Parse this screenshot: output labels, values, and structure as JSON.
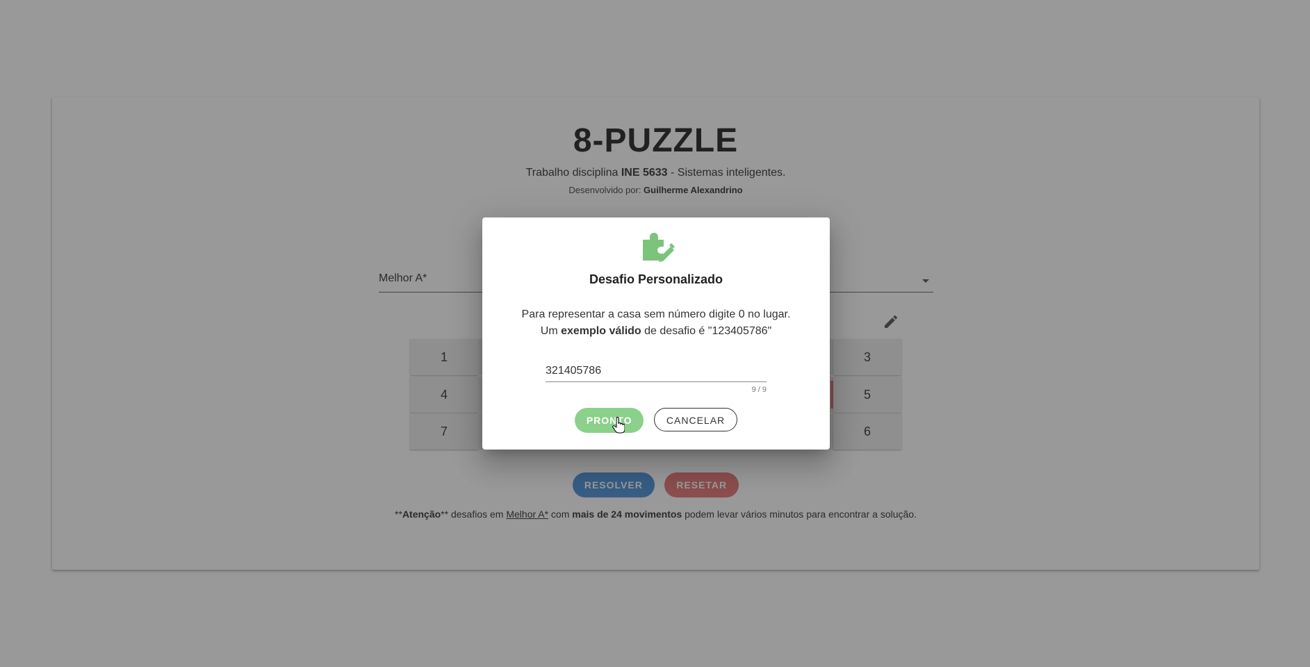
{
  "page": {
    "title": "8-PUZZLE",
    "subtitle_prefix": "Trabalho disciplina ",
    "subtitle_bold": "INE 5633",
    "subtitle_suffix": " - Sistemas inteligentes.",
    "author_prefix": "Desenvolvido por: ",
    "author_name": "Guilherme Alexandrino"
  },
  "algorithm_select": {
    "value": "Melhor A*"
  },
  "board": {
    "tiles_left": [
      "1",
      "4",
      "7"
    ],
    "tiles_right": [
      "3",
      "5",
      "6"
    ]
  },
  "actions": {
    "solve_label": "RESOLVER",
    "reset_label": "RESETAR"
  },
  "note": {
    "p1": "**",
    "b1": "Atenção",
    "p2": "** desafios em ",
    "link": "Melhor A*",
    "p3": " com ",
    "b2": "mais de 24 movimentos",
    "p4": " podem levar vários minutos para encontrar a solução."
  },
  "dialog": {
    "title": "Desafio Personalizado",
    "line1": "Para representar a casa sem número digite 0 no lugar.",
    "line2_prefix": "Um ",
    "line2_bold": "exemplo válido",
    "line2_suffix": " de desafio é \"123405786\"",
    "input_value": "321405786",
    "counter": "9 / 9",
    "confirm_label": "PRONTO",
    "cancel_label": "CANCELAR"
  },
  "colors": {
    "accent_green": "#8bd08b",
    "solve_blue": "#4a90d9",
    "reset_red": "#e57373"
  },
  "icons": {
    "dialog_icon": "puzzle-edit-icon",
    "edit_icon": "pencil-icon"
  }
}
